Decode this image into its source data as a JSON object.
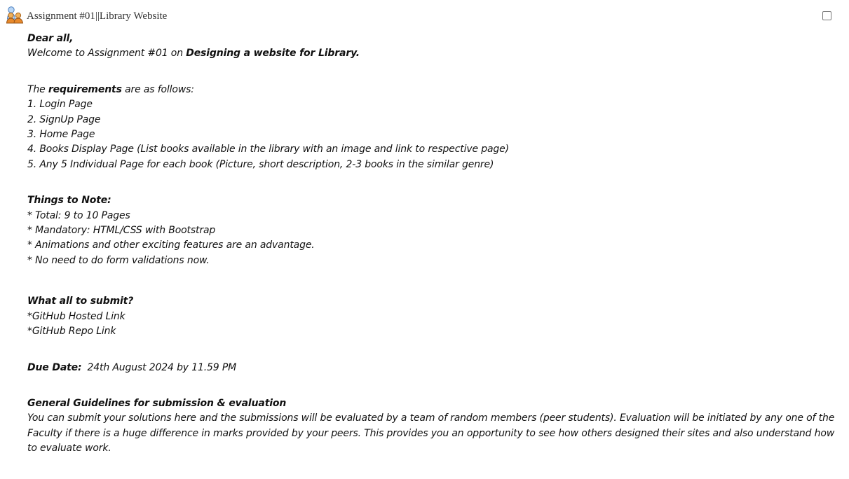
{
  "header": {
    "title": "Assignment #01||Library Website",
    "icon": "users-icon"
  },
  "body": {
    "greeting": "Dear all,",
    "welcome_prefix": "Welcome to Assignment #01 on ",
    "welcome_bold": "Designing a website for Library.",
    "req_prefix": "The ",
    "req_bold": "requirements",
    "req_suffix": " are as follows:",
    "requirements": [
      "1. Login Page",
      "2. SignUp Page",
      "3. Home Page",
      "4. Books Display Page (List books available in the library with an image and link to respective page)",
      "5. Any 5 Individual Page for each book (Picture, short description, 2-3 books in the similar genre)"
    ],
    "notes_heading": "Things to Note:",
    "notes": [
      "* Total: 9 to 10 Pages",
      "* Mandatory: HTML/CSS with Bootstrap",
      "* Animations and other exciting features are an advantage.",
      "* No need to do form validations now."
    ],
    "submit_heading": "What all to submit?",
    "submit_items": [
      "*GitHub Hosted Link",
      "*GitHub Repo Link"
    ],
    "due_label": "Due Date:",
    "due_value": "24th August 2024 by 11.59 PM",
    "guidelines_heading": "General Guidelines for submission & evaluation",
    "guidelines_text": "You can submit your solutions here and the submissions will be evaluated by a team of random members (peer students). Evaluation will be initiated by any one of the Faculty if there is a huge difference in marks provided by your peers. This provides you an opportunity to see how others designed their sites and also understand how to evaluate work."
  }
}
